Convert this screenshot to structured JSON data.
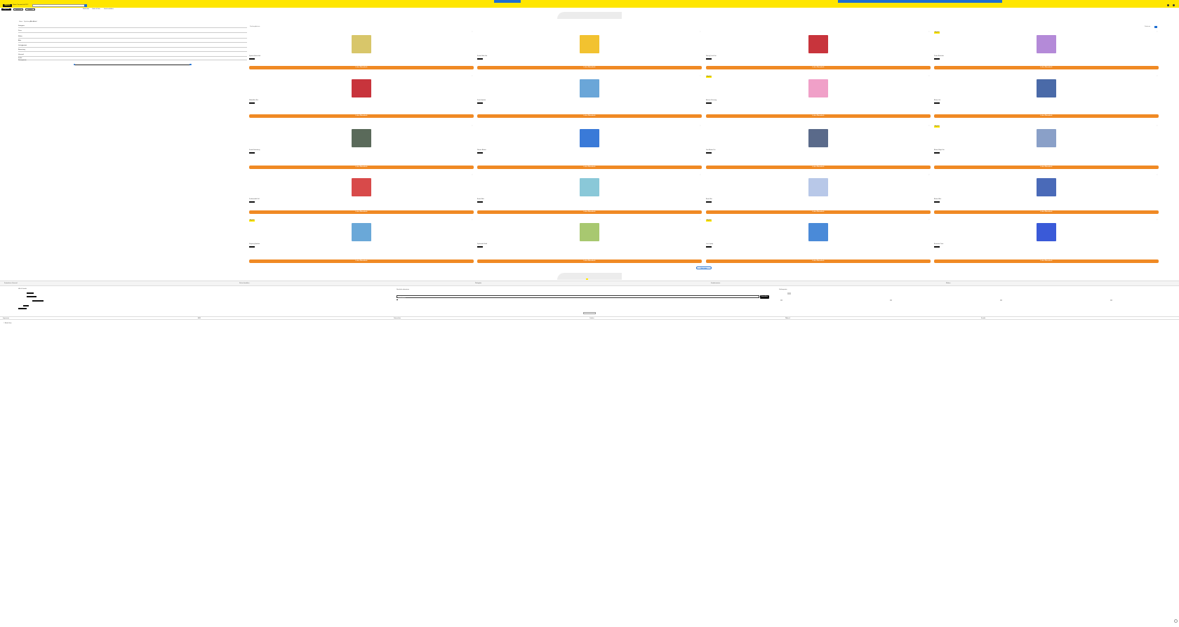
{
  "header": {
    "logo": "MEDIA",
    "promo": "Gratis Versand ab 59 €",
    "search_placeholder": "Suchbegriff eingeben",
    "top_links": [
      "Mein Konto",
      "Warenkorb"
    ]
  },
  "nav": {
    "buttons": [
      "Angebote",
      "Spielzeug",
      "Marken"
    ],
    "links": [
      "Neuheiten",
      "Outlet & Sale",
      "Geschenkideen"
    ]
  },
  "breadcrumb": [
    "Home",
    "Spielzeug",
    "Alle Artikel"
  ],
  "filters": [
    "Kategorie",
    "Preis",
    "Marke",
    "Alter",
    "Verfügbarkeit",
    "Bewertung",
    "Versand",
    "Farbe",
    "Preisspanne"
  ],
  "listing": {
    "results_label": "Suchergebnisse",
    "sort_label": "Sortieren",
    "load_more": "Mehr laden"
  },
  "products": [
    {
      "badge": "",
      "title": "Spielset Bauernhof",
      "price": "",
      "color": "#d8c66a"
    },
    {
      "badge": "",
      "title": "Kreativ Stifte Set",
      "price": "",
      "color": "#f2c230"
    },
    {
      "badge": "",
      "title": "Racing Track Set",
      "price": "",
      "color": "#c8343c"
    },
    {
      "badge": "Angebot",
      "title": "Perlen Bastelset",
      "price": "",
      "color": "#b48ad8"
    },
    {
      "badge": "",
      "title": "Robot Auto Rot",
      "price": "",
      "color": "#c8343c"
    },
    {
      "badge": "",
      "title": "Knete Spielset",
      "price": "",
      "color": "#6aa6d8"
    },
    {
      "badge": "Angebot",
      "title": "Einhorn Fahrzeug",
      "price": "",
      "color": "#f0a0c8"
    },
    {
      "badge": "",
      "title": "Blaster Set",
      "price": "",
      "color": "#4a6aa8"
    },
    {
      "badge": "",
      "title": "Kreisel Sammlung",
      "price": "",
      "color": "#5a6a5a"
    },
    {
      "badge": "",
      "title": "Wasser Blaster",
      "price": "",
      "color": "#3a7ad8"
    },
    {
      "badge": "",
      "title": "Dart Blaster Pro",
      "price": "",
      "color": "#5a6a8a"
    },
    {
      "badge": "Angebot",
      "title": "Blaster Mega Set",
      "price": "",
      "color": "#8aa0c8"
    },
    {
      "badge": "",
      "title": "Zauberwürfel 3x3",
      "price": "",
      "color": "#d84a4a"
    },
    {
      "badge": "",
      "title": "Bunte Stifte",
      "price": "",
      "color": "#8ac8d8"
    },
    {
      "badge": "",
      "title": "Bastel Set",
      "price": "",
      "color": "#b8c8e8"
    },
    {
      "badge": "",
      "title": "Blaster Blau",
      "price": "",
      "color": "#4a6ab8"
    },
    {
      "badge": "Angebot",
      "title": "Flugzeug Spielset",
      "price": "",
      "color": "#6aa8d8"
    },
    {
      "badge": "",
      "title": "Spielmatte Stadt",
      "price": "",
      "color": "#a8c870"
    },
    {
      "badge": "Angebot",
      "title": "Lern Laptop",
      "price": "",
      "color": "#4a8ad8"
    },
    {
      "badge": "",
      "title": "Bausteine Turm",
      "price": "",
      "color": "#3a5ad8"
    }
  ],
  "cart_label": "In den Warenkorb",
  "footer": {
    "band": [
      "Kostenloser Versand",
      "Sicher bezahlen",
      "Rückgabe",
      "Kundenservice",
      "Filialen"
    ],
    "newsletter_title": "Newsletter abonnieren",
    "newsletter_placeholder": "E-Mail-Adresse",
    "subscribe": "Anmelden",
    "help_title": "Hilfe & Kontakt",
    "payment_title": "Zahlungsarten",
    "bottom_links": [
      "Impressum",
      "AGB",
      "Datenschutz",
      "Cookies",
      "Widerruf",
      "Kontakt"
    ],
    "copyright": "© Media Store"
  },
  "colors": {
    "accent_blue": "#1f6fd1",
    "brand_yellow": "#ffe600",
    "cart_orange": "#f08a24"
  }
}
